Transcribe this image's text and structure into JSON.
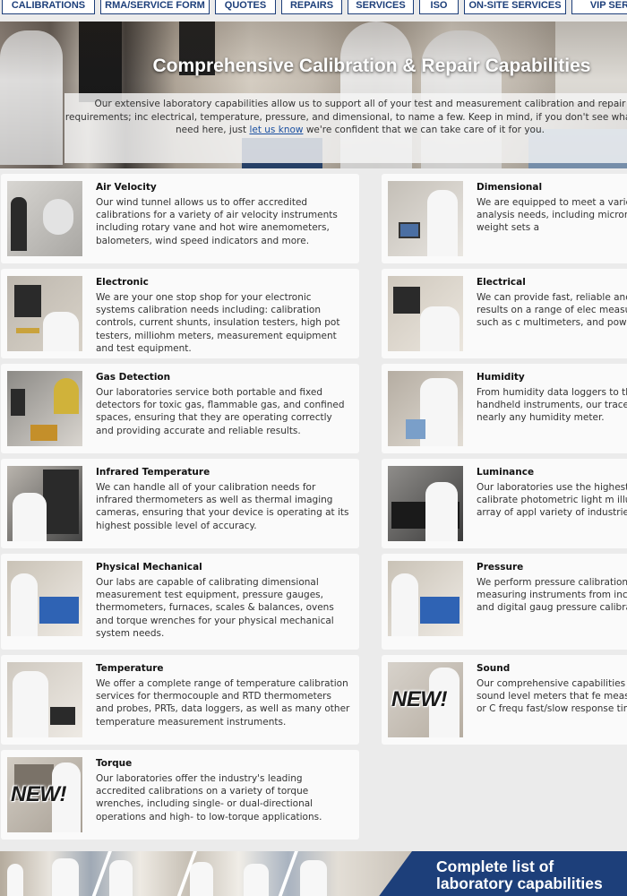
{
  "nav": {
    "items": [
      "CALIBRATIONS",
      "RMA/SERVICE FORM",
      "QUOTES",
      "REPAIRS",
      "SERVICES",
      "ISO",
      "ON-SITE SERVICES",
      "VIP SERV"
    ]
  },
  "hero": {
    "title": "Comprehensive Calibration & Repair Capabilities",
    "desc_before": "Our extensive laboratory capabilities allow us to support all of your test and measurement calibration and repair requirements; inc electrical, temperature, pressure, and dimensional, to name a few. Keep in mind, if you don't see what you need here, just ",
    "desc_link": "let us know",
    "desc_after": " we're confident that we can take care of it for you."
  },
  "capabilities": [
    {
      "title": "Air Velocity",
      "text": "Our wind tunnel allows us to offer accredited calibrations for a variety of air velocity instruments including rotary vane and hot wire anemometers, balometers, wind speed indicators and more.",
      "new": false
    },
    {
      "title": "Dimensional",
      "text": "We are equipped to meet a variety of calibration analysis needs, including micrometers, precision weight sets a",
      "new": false
    },
    {
      "title": "Electronic",
      "text": "We are your one stop shop for your electronic systems calibration needs including: calibration controls, current shunts, insulation testers, high pot testers, milliohm meters, measurement equipment and test equipment.",
      "new": false
    },
    {
      "title": "Electrical",
      "text": "We can provide fast, reliable and high calibration results on a range of elec measurement instruments, such as c multimeters, and power supplies.",
      "new": false
    },
    {
      "title": "Gas Detection",
      "text": "Our laboratories service both portable and fixed detectors for toxic gas, flammable gas, and confined spaces, ensuring that they are operating correctly and providing accurate and reliable results.",
      "new": false
    },
    {
      "title": "Humidity",
      "text": "From humidity data loggers to therm accuracy handheld instruments, our traceable calibrations for nearly any humidity meter.",
      "new": false
    },
    {
      "title": "Infrared Temperature",
      "text": "We can handle all of your calibration needs for infrared thermometers as well as thermal imaging cameras, ensuring that your device is operating at its highest possible level of accuracy.",
      "new": false
    },
    {
      "title": "Luminance",
      "text": "Our laboratories use the highest spe order to calibrate photometric light m illuminance for a broad array of appl variety of industries.",
      "new": false
    },
    {
      "title": "Physical Mechanical",
      "text": "Our labs are capable of calibrating dimensional measurement test equipment, pressure gauges, thermometers, furnaces, scales & balances, ovens and torque wrenches for your physical mechanical system needs.",
      "new": false
    },
    {
      "title": "Pressure",
      "text": "We perform pressure calibrations on vacuum measuring instruments from including analog/dial and digital gaug pressure calibrators.",
      "new": false
    },
    {
      "title": "Temperature",
      "text": "We offer a complete range of temperature calibration services for thermocouple and RTD thermometers and probes, PRTs, data loggers, as well as many other temperature measurement instruments.",
      "new": false
    },
    {
      "title": "Sound",
      "text": "Our comprehensive capabilities inclu and digital sound level meters that fe measurement ranges; A, B or C frequ fast/slow response times.",
      "new": true
    },
    {
      "title": "Torque",
      "text": "Our laboratories offer the industry's leading accredited calibrations on a variety of torque wrenches, including single- or dual-directional operations and high- to low-torque applications.",
      "new": true
    }
  ],
  "new_badge": "NEW!",
  "banner": {
    "title_line1": "Complete list of",
    "title_line2": "laboratory capabilities"
  },
  "colors": {
    "nav_text": "#1d3f7a",
    "link": "#1a4fa0",
    "banner_bg": "#1d3f7a",
    "page_bg": "#ebebeb",
    "card_bg": "#fafafa"
  }
}
